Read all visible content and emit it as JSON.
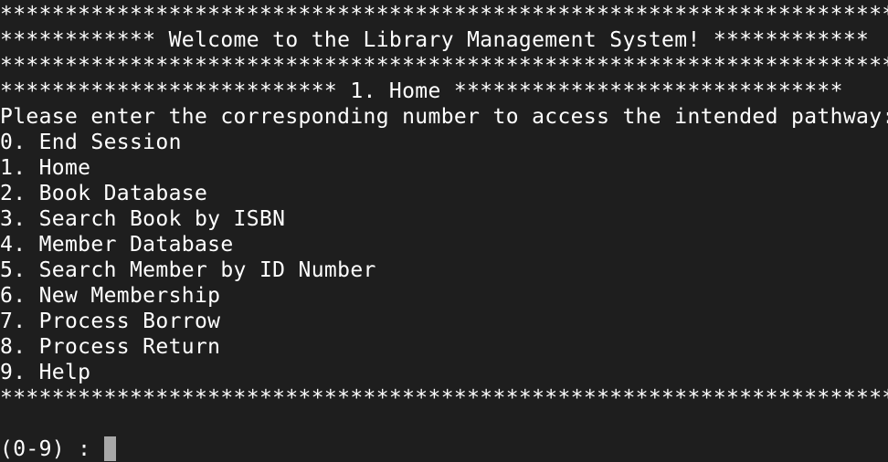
{
  "banner": {
    "stars_top": "**********************************************************************",
    "welcome": "************ Welcome to the Library Management System! ************",
    "stars_mid": "**********************************************************************",
    "section": "************************** 1. Home ******************************"
  },
  "instruction": "Please enter the corresponding number to access the intended pathway:",
  "menu": {
    "items": [
      {
        "label": "0. End Session"
      },
      {
        "label": "1. Home"
      },
      {
        "label": "2. Book Database"
      },
      {
        "label": "3. Search Book by ISBN"
      },
      {
        "label": "4. Member Database"
      },
      {
        "label": "5. Search Member by ID Number"
      },
      {
        "label": "6. New Membership"
      },
      {
        "label": "7. Process Borrow"
      },
      {
        "label": "8. Process Return"
      },
      {
        "label": "9. Help"
      }
    ]
  },
  "footer": {
    "stars_bottom": "**********************************************************************"
  },
  "prompt": {
    "text": "(0-9) : "
  },
  "colors": {
    "background": "#1e1e1e",
    "text": "#ffffff",
    "cursor": "#a8a8a8"
  }
}
